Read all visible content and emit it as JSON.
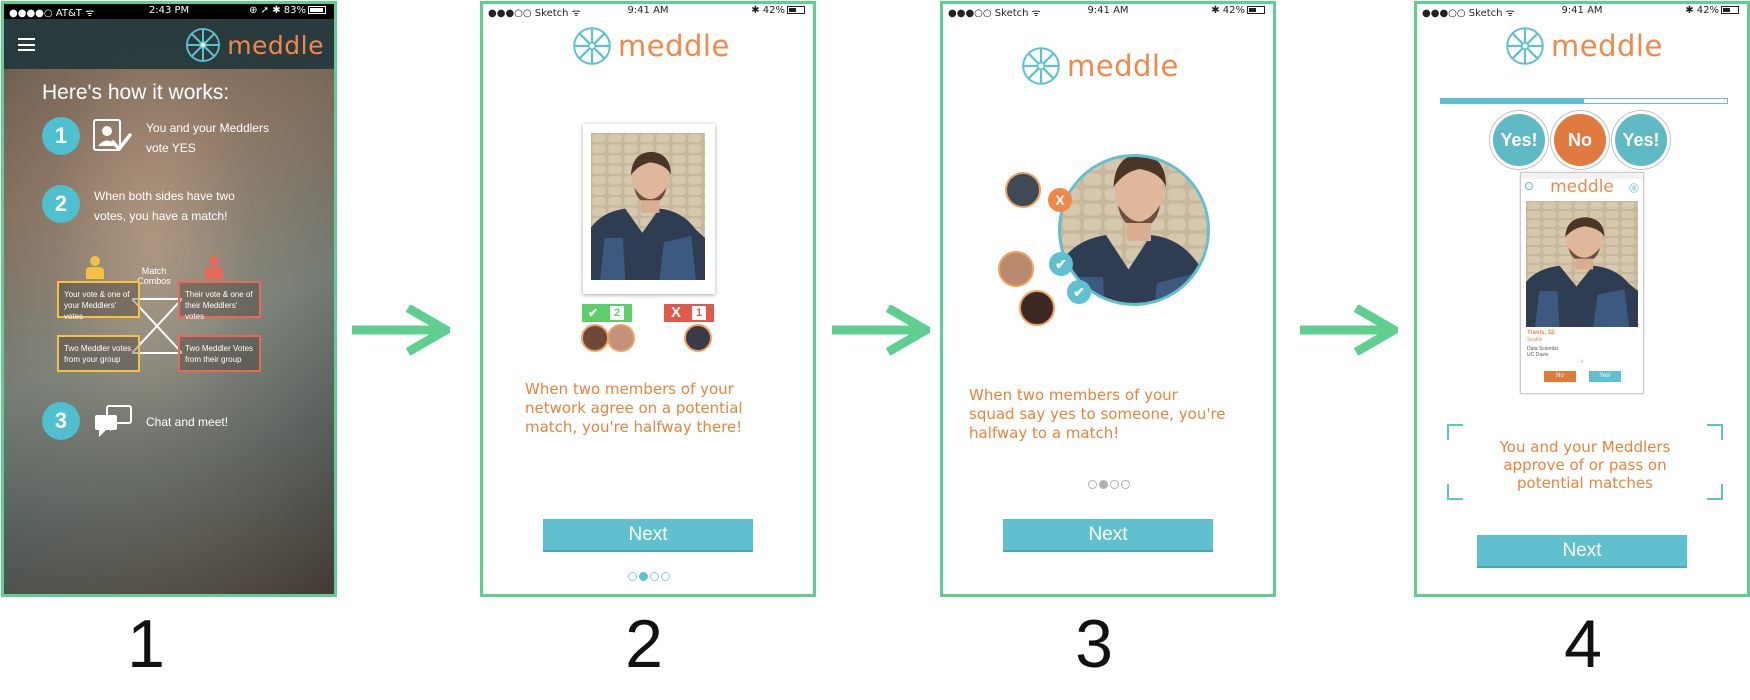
{
  "phones": [
    {
      "status": {
        "carrier": "●●●●○ AT&T ᯤ",
        "time": "2:43 PM",
        "right": "⊕ ➚ ✱ 83%"
      },
      "brand": "meddle",
      "title": "Here's how it works:",
      "steps": [
        {
          "number": "1",
          "line1": "You and your Meddlers",
          "line2": "vote YES"
        },
        {
          "number": "2",
          "line1": "When both sides have two",
          "line2": "votes, you have a match!"
        },
        {
          "number": "3",
          "line1": "Chat and meet!",
          "line2": ""
        }
      ],
      "combos": {
        "label1": "Match",
        "label2": "Combos",
        "boxes": [
          {
            "line1": "Your vote & one of",
            "line2": "your Meddlers' votes"
          },
          {
            "line1": "Their vote & one of",
            "line2": "their Meddlers' votes"
          },
          {
            "line1": "Two Meddler votes",
            "line2": "from your group"
          },
          {
            "line1": "Two Meddler Votes",
            "line2": "from their group"
          }
        ]
      }
    },
    {
      "status": {
        "carrier": "●●●○○ Sketch ᯤ",
        "time": "9:41 AM",
        "right": "✱ 42%"
      },
      "brand": "meddle",
      "yes_count": "2",
      "no_count": "1",
      "yes_symbol": "✔",
      "no_symbol": "X",
      "caption": [
        "When two members of your",
        "network agree on a potential",
        "match, you're halfway there!"
      ],
      "next": "Next"
    },
    {
      "status": {
        "carrier": "●●●○○ Sketch ᯤ",
        "time": "9:41 AM",
        "right": "✱ 42%"
      },
      "brand": "meddle",
      "x_mark": "X",
      "check_mark": "✔",
      "caption": [
        "When two members of your",
        "squad say yes to someone, you're",
        "halfway to a match!"
      ],
      "next": "Next"
    },
    {
      "status": {
        "carrier": "●●●○○ Sketch ᯤ",
        "time": "9:41 AM",
        "right": "✱ 42%"
      },
      "brand": "meddle",
      "progress": 0.5,
      "votes": [
        "Yes!",
        "No",
        "Yes!"
      ],
      "mini_screen": {
        "brand": "meddle",
        "name": "Travis, 32",
        "location": "Seattle",
        "job": "Data Scientist",
        "school": "UC Davis",
        "no": "No",
        "yes": "Yes!"
      },
      "caption": [
        "You and your Meddlers",
        "approve of or pass on",
        "potential matches"
      ],
      "next": "Next"
    }
  ],
  "step_numbers": [
    "1",
    "2",
    "3",
    "4"
  ],
  "colors": {
    "frame": "#5fcf8f",
    "accent_teal": "#5fc1cf",
    "brand_orange": "#f0884a",
    "yes_green": "#5ccf6a",
    "no_red": "#e05a4c",
    "combo_yellow": "#f5c144",
    "combo_red": "#e8695a"
  }
}
